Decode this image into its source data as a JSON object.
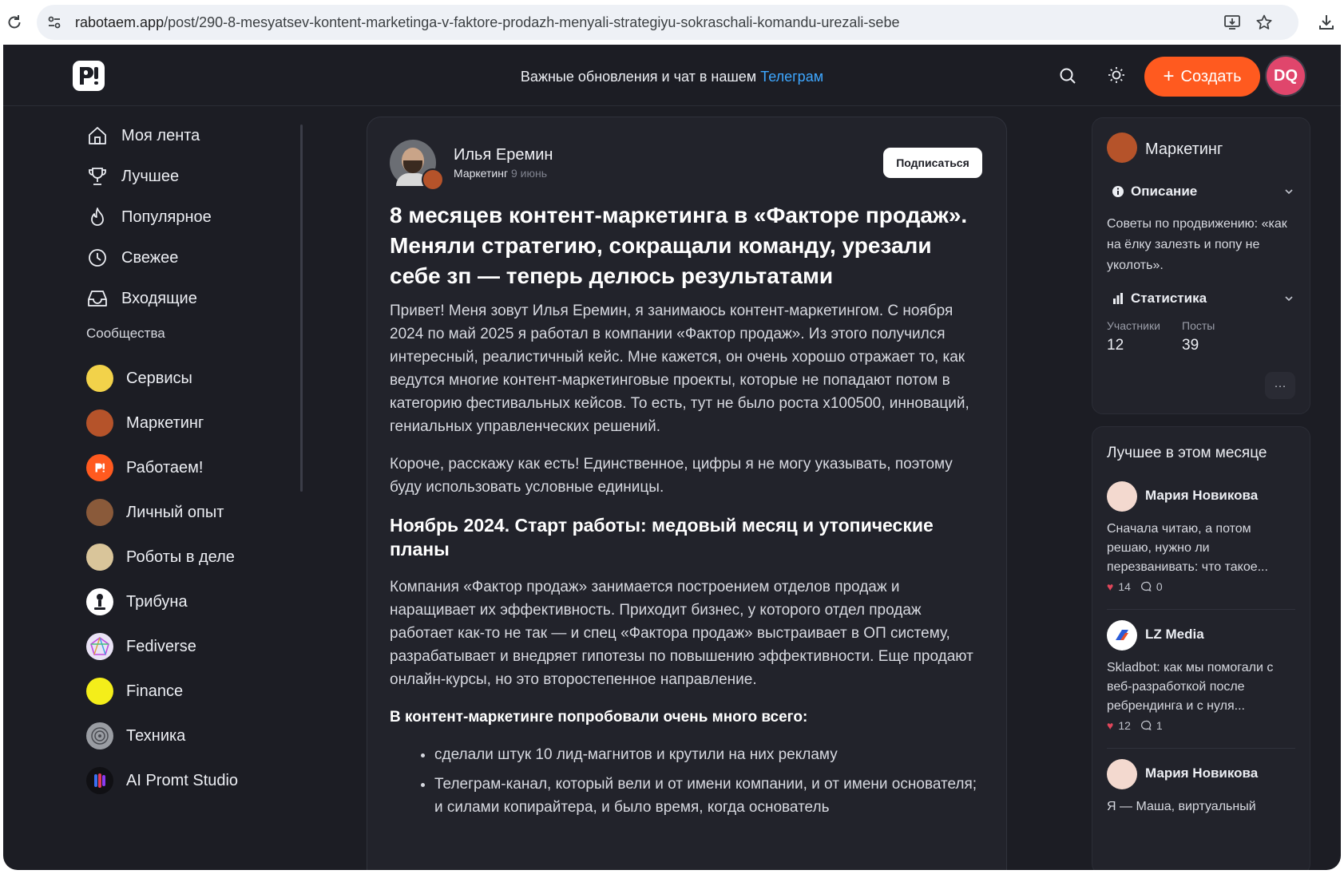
{
  "browser": {
    "url_host": "rabotaem.app",
    "url_path": "/post/290-8-mesyatsev-kontent-marketinga-v-faktore-prodazh-menyali-strategiyu-sokraschali-komandu-urezali-sebe"
  },
  "header": {
    "announcement": "Важные обновления и чат в нашем",
    "announcement_link": "Телеграм",
    "create_label": "Создать",
    "user_initials": "DQ"
  },
  "sidebar": {
    "nav": [
      {
        "label": "Моя лента",
        "icon": "home-icon"
      },
      {
        "label": "Лучшее",
        "icon": "trophy-icon"
      },
      {
        "label": "Популярное",
        "icon": "flame-icon"
      },
      {
        "label": "Свежее",
        "icon": "clock-icon"
      },
      {
        "label": "Входящие",
        "icon": "inbox-icon"
      }
    ],
    "communities_label": "Сообщества",
    "communities": [
      {
        "label": "Сервисы",
        "color": "#f2d24a"
      },
      {
        "label": "Маркетинг",
        "color": "#b5532a"
      },
      {
        "label": "Работаем!",
        "color": "#ff5a1f"
      },
      {
        "label": "Личный опыт",
        "color": "#8a5a3a"
      },
      {
        "label": "Роботы в деле",
        "color": "#d9c59a"
      },
      {
        "label": "Трибуна",
        "color": "#ffffff"
      },
      {
        "label": "Fediverse",
        "color": "#e9e3f5"
      },
      {
        "label": "Finance",
        "color": "#f4ee1a"
      },
      {
        "label": "Техника",
        "color": "#9a9da3"
      },
      {
        "label": "AI Promt Studio",
        "color": "#101014"
      }
    ]
  },
  "post": {
    "author": "Илья Еремин",
    "community": "Маркетинг",
    "date": "9 июнь",
    "subscribe_label": "Подписаться",
    "title": "8 месяцев контент-маркетинга в «Факторе продаж». Меняли стратегию, сокращали команду, урезали себе зп — теперь делюсь результатами",
    "p1": "Привет! Меня зовут Илья Еремин, я занимаюсь контент-маркетингом. С ноября 2024 по май 2025 я работал в компании «Фактор продаж». Из этого получился интересный, реалистичный кейс. Мне кажется, он очень хорошо отражает то, как ведутся многие контент-маркетинговые проекты, которые не попадают потом в категорию фестивальных кейсов. То есть, тут не было роста х100500, инноваций, гениальных управленческих решений.",
    "p2": "Короче, расскажу как есть! Единственное, цифры я не могу указывать, поэтому буду использовать условные единицы.",
    "h2": "Ноябрь 2024. Старт работы: медовый месяц и утопические планы",
    "p3": "Компания «Фактор продаж» занимается построением отделов продаж и наращивает их эффективность. Приходит бизнес, у которого отдел продаж работает как-то не так — и спец «Фактора продаж» выстраивает в ОП систему, разрабатывает и внедряет гипотезы по повышению эффективности. Еще продают онлайн-курсы, но это второстепенное направление.",
    "p4": "В контент-маркетинге попробовали очень много всего:",
    "list": [
      "сделали штук 10 лид-магнитов и крутили на них рекламу",
      "Телеграм-канал, который вели и от имени компании, и от имени основателя; и силами копирайтера, и было время, когда основатель"
    ]
  },
  "community_card": {
    "name": "Маркетинг",
    "description_label": "Описание",
    "description": "Советы по продвижению: «как на ёлку залезть и попу не уколоть».",
    "stats_label": "Статистика",
    "members_label": "Участники",
    "members": "12",
    "posts_label": "Посты",
    "posts": "39",
    "more_label": "···"
  },
  "best": {
    "title": "Лучшее в этом месяце",
    "items": [
      {
        "author": "Мария Новикова",
        "text": "Сначала читаю, а потом решаю, нужно ли перезванивать: что такое...",
        "likes": "14",
        "comments": "0"
      },
      {
        "author": "LZ Media",
        "text": "Skladbot: как мы помогали с веб-разработкой после ребрендинга и с нуля...",
        "likes": "12",
        "comments": "1"
      },
      {
        "author": "Мария Новикова",
        "text": "Я — Маша, виртуальный",
        "likes": "",
        "comments": ""
      }
    ]
  }
}
